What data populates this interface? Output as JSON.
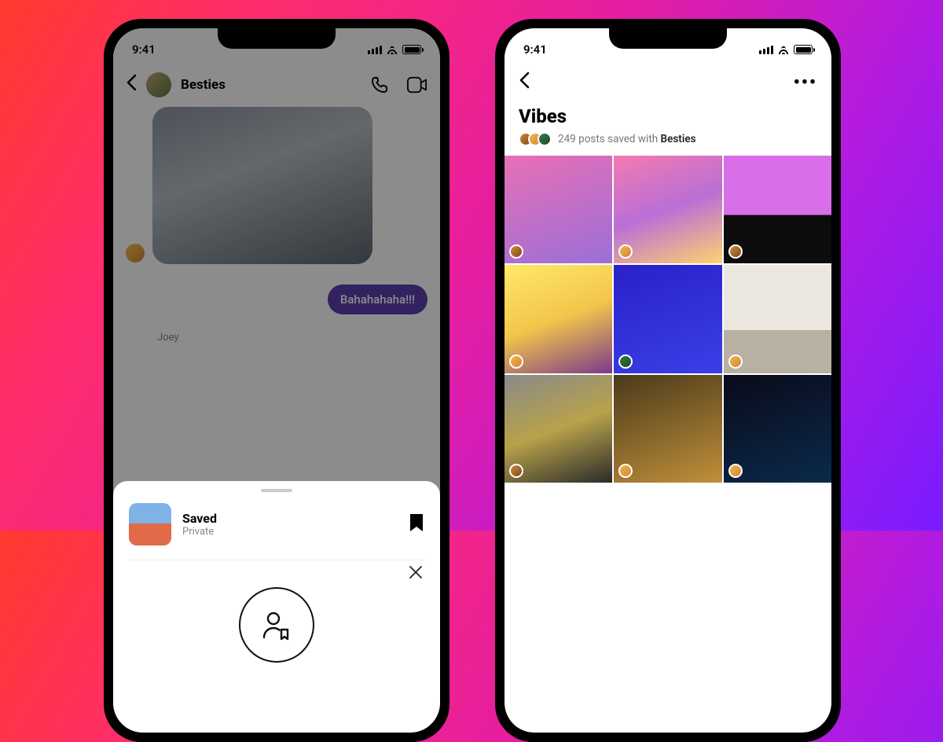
{
  "status": {
    "time": "9:41"
  },
  "left": {
    "chat_title": "Besties",
    "bubble": "Bahahahaha!!!",
    "sender": "Joey",
    "sheet": {
      "title": "Saved",
      "subtitle": "Private"
    }
  },
  "right": {
    "title": "Vibes",
    "posts_count": "249",
    "posts_text": "posts saved with",
    "group": "Besties"
  }
}
